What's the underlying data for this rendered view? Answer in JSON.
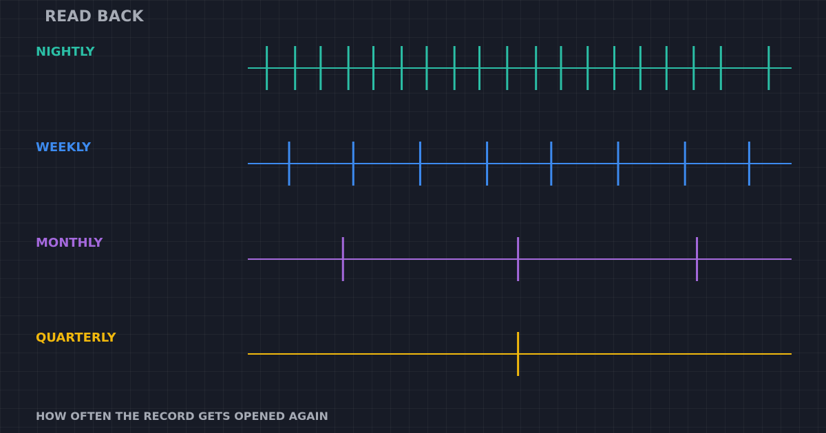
{
  "title": "READ BACK",
  "caption": "HOW OFTEN THE RECORD GETS OPENED AGAIN",
  "colors": {
    "background": "#171b26",
    "title": "#a6abb5",
    "caption": "#a6abb5"
  },
  "rows": [
    {
      "label": "NIGHTLY",
      "color": "#2bbfa6",
      "tick_count": 19,
      "tick_positions": [
        0.035,
        0.087,
        0.134,
        0.185,
        0.231,
        0.283,
        0.329,
        0.38,
        0.426,
        0.477,
        0.53,
        0.576,
        0.625,
        0.674,
        0.722,
        0.77,
        0.82,
        0.87,
        0.958
      ]
    },
    {
      "label": "WEEKLY",
      "color": "#3d8bf0",
      "tick_count": 8,
      "tick_positions": [
        0.076,
        0.194,
        0.317,
        0.44,
        0.558,
        0.681,
        0.804,
        0.922
      ]
    },
    {
      "label": "MONTHLY",
      "color": "#a569dd",
      "tick_count": 3,
      "tick_positions": [
        0.175,
        0.497,
        0.826
      ]
    },
    {
      "label": "QUARTERLY",
      "color": "#f2b90d",
      "tick_count": 1,
      "tick_positions": [
        0.497
      ]
    }
  ]
}
